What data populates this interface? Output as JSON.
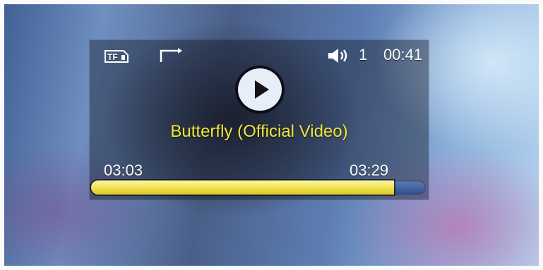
{
  "status_bar": {
    "storage_icon": "tf-card-icon",
    "repeat_icon": "repeat-icon",
    "volume_icon": "speaker-icon",
    "volume_level": "1",
    "clock": "00:41"
  },
  "player": {
    "state_icon": "play-icon",
    "track_title": "Butterfly (Official Video)",
    "elapsed_time": "03:03",
    "total_time": "03:29",
    "progress": 0.905
  },
  "colors": {
    "title": "#f1e63a",
    "progress_fill": "#f0e24a",
    "progress_track": "#3e5f9e",
    "text": "#ffffff"
  }
}
